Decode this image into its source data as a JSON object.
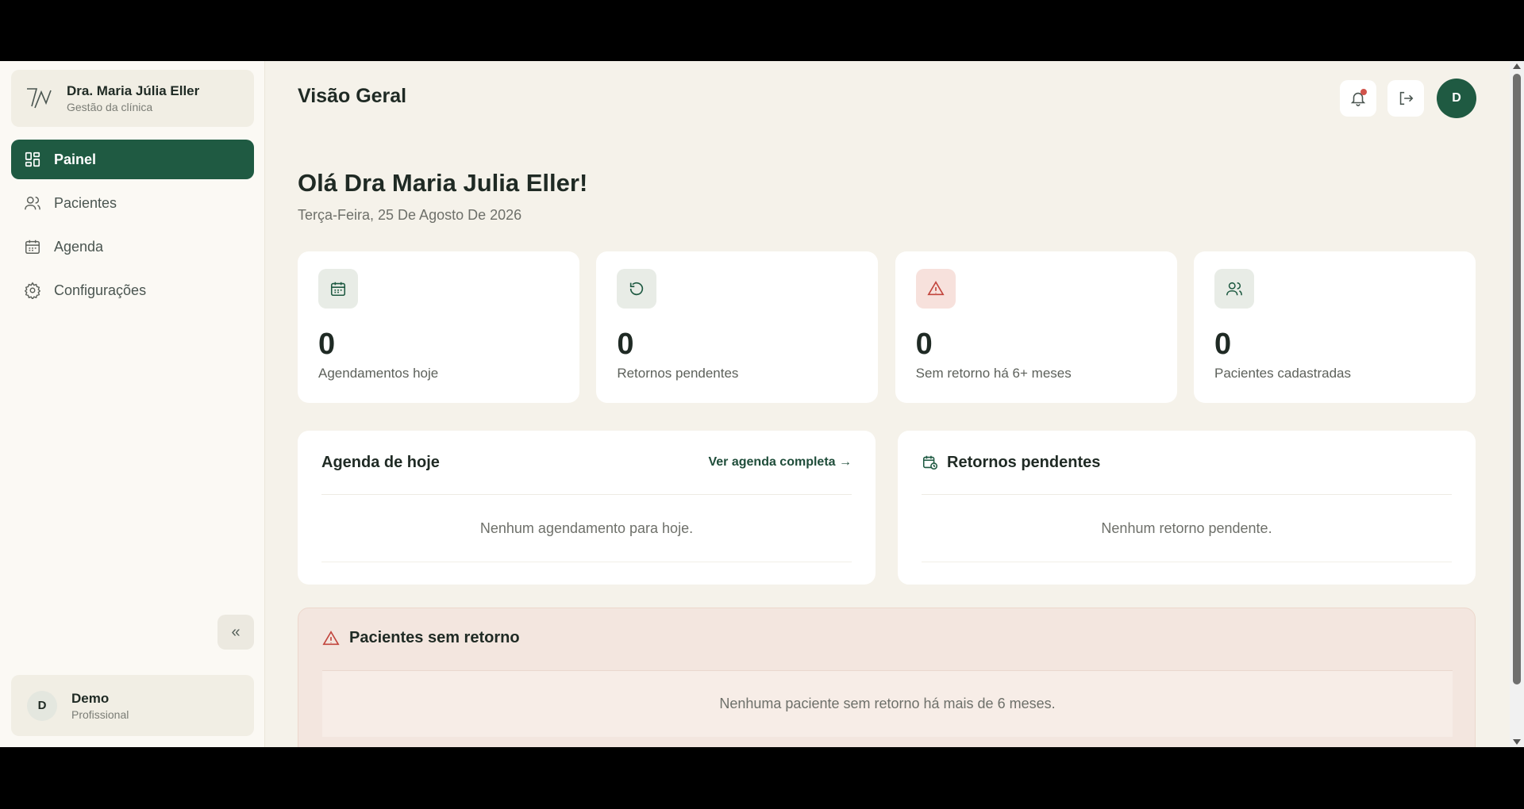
{
  "brand": {
    "name": "Dra. Maria Júlia Eller",
    "subtitle": "Gestão da clínica"
  },
  "nav": [
    {
      "label": "Painel",
      "icon": "dashboard-icon",
      "active": true
    },
    {
      "label": "Pacientes",
      "icon": "users-icon",
      "active": false
    },
    {
      "label": "Agenda",
      "icon": "calendar-icon",
      "active": false
    },
    {
      "label": "Configurações",
      "icon": "gear-icon",
      "active": false
    }
  ],
  "collapse_label": "«",
  "user": {
    "initial": "D",
    "name": "Demo",
    "role": "Profissional"
  },
  "header": {
    "title": "Visão Geral",
    "avatar_initial": "D"
  },
  "greeting": "Olá Dra Maria Julia Eller!",
  "date": "Terça-Feira, 25 De Agosto De 2026",
  "stats": [
    {
      "value": "0",
      "label": "Agendamentos hoje",
      "icon": "calendar-icon"
    },
    {
      "value": "0",
      "label": "Retornos pendentes",
      "icon": "refresh-icon"
    },
    {
      "value": "0",
      "label": "Sem retorno há 6+ meses",
      "icon": "warning-icon"
    },
    {
      "value": "0",
      "label": "Pacientes cadastradas",
      "icon": "users-icon"
    }
  ],
  "agenda": {
    "title": "Agenda de hoje",
    "link": "Ver agenda completa →",
    "empty": "Nenhum agendamento para hoje."
  },
  "retornos": {
    "title": "Retornos pendentes",
    "empty": "Nenhum retorno pendente."
  },
  "sem_retorno": {
    "title": "Pacientes sem retorno",
    "empty": "Nenhuma paciente sem retorno há mais de 6 meses."
  },
  "colors": {
    "accent": "#1f5a42",
    "background": "#f5f2ea",
    "warning": "#d0534b"
  }
}
